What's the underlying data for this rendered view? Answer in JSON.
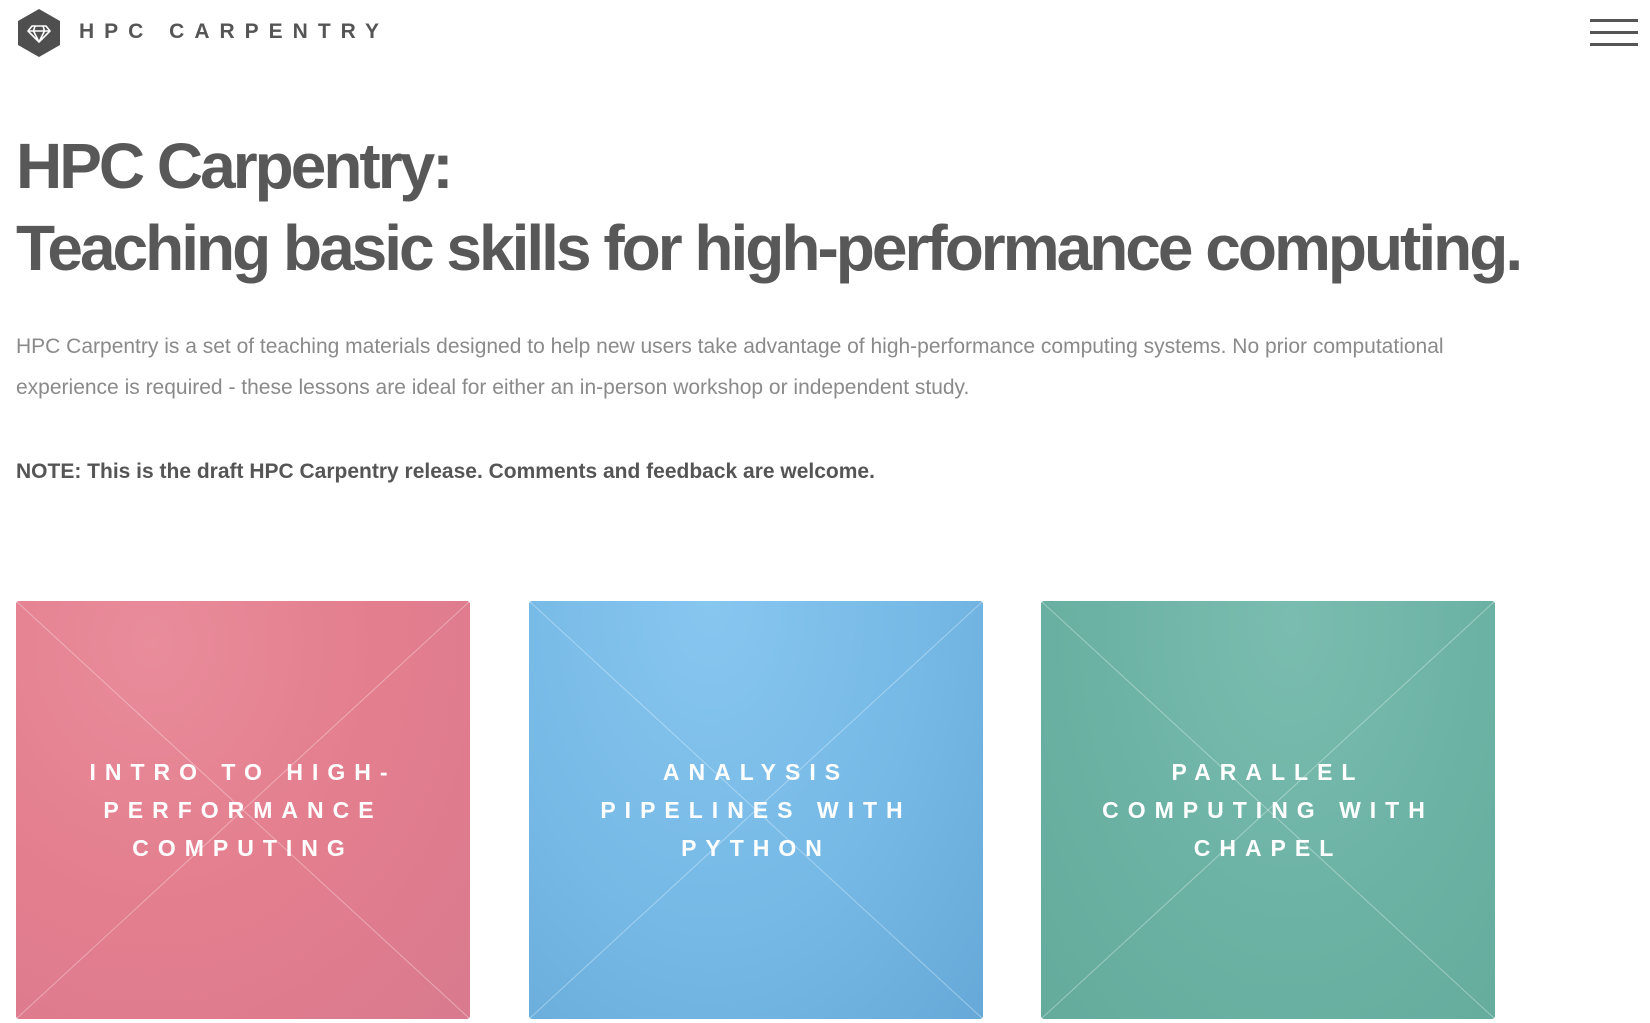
{
  "header": {
    "brand": "HPC CARPENTRY",
    "logo_icon": "diamond-hexagon-icon",
    "menu_icon": "hamburger-menu-icon"
  },
  "hero": {
    "title_line1": "HPC Carpentry:",
    "title_line2": "Teaching basic skills for high-performance computing."
  },
  "intro": "HPC Carpentry is a set of teaching materials designed to help new users take advantage of high-performance computing systems. No prior computational experience is required - these lessons are ideal for either an in-person workshop or independent study.",
  "note": "NOTE: This is the draft HPC Carpentry release. Comments and feedback are welcome.",
  "cards": [
    {
      "title": "INTRO TO HIGH-PERFORMANCE COMPUTING",
      "color": "#e5838f"
    },
    {
      "title": "ANALYSIS PIPELINES WITH PYTHON",
      "color": "#76b9e6"
    },
    {
      "title": "PARALLEL COMPUTING WITH CHAPEL",
      "color": "#6db3a5"
    }
  ],
  "colors": {
    "text": "#585858",
    "muted_text": "#8a8a8a",
    "background": "#ffffff"
  }
}
